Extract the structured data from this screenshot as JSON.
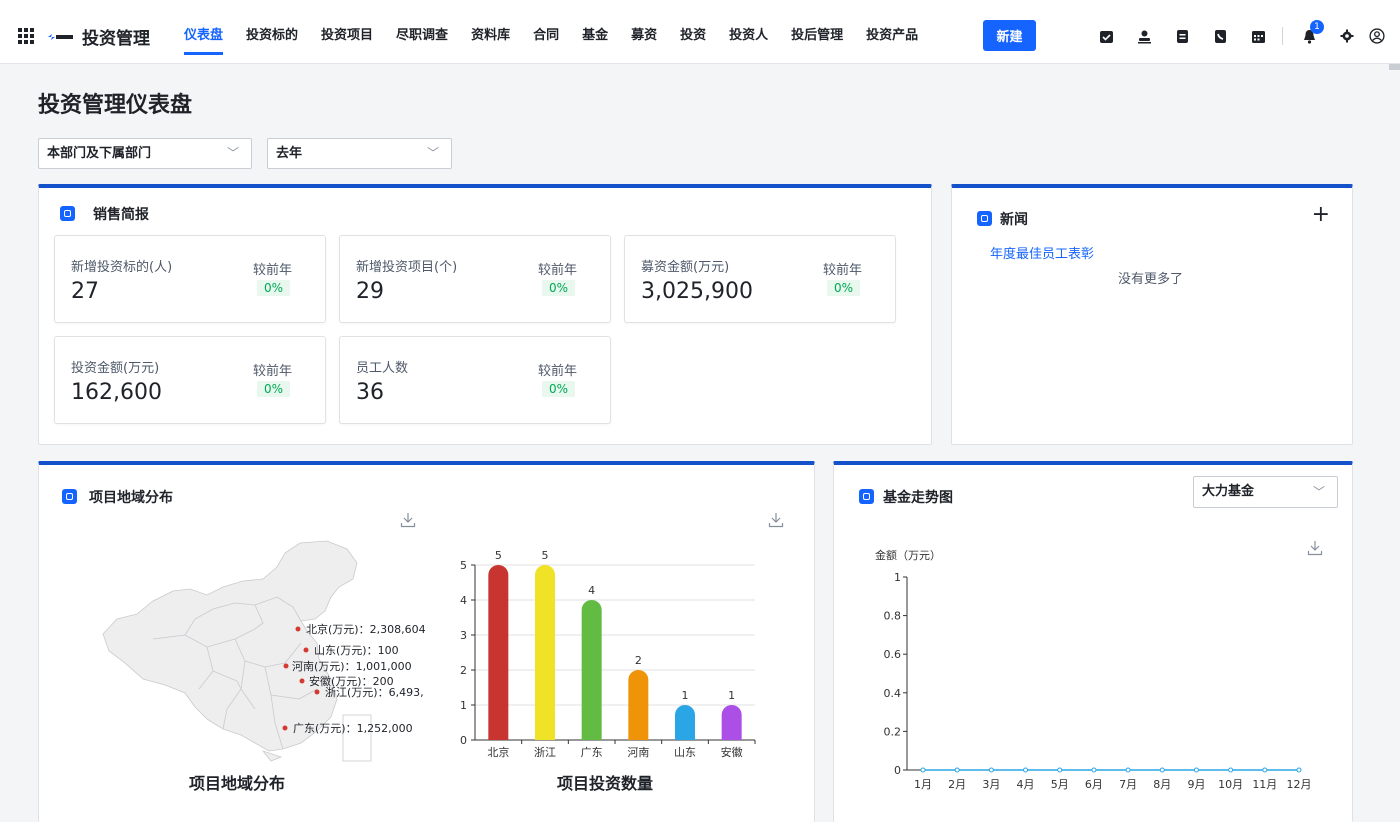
{
  "header": {
    "app_title": "投资管理",
    "nav": [
      "仪表盘",
      "投资标的",
      "投资项目",
      "尽职调查",
      "资料库",
      "合同",
      "基金",
      "募资",
      "投资",
      "投资人",
      "投后管理",
      "投资产品"
    ],
    "new_label": "新建",
    "notification_count": "1",
    "icons": [
      "calendar-check-icon",
      "user-icon",
      "note-icon",
      "contact-book-icon",
      "calendar-icon",
      "bell-icon",
      "settings-icon",
      "profile-icon"
    ]
  },
  "page": {
    "title": "投资管理仪表盘",
    "dept_filter": "本部门及下属部门",
    "period_filter": "去年"
  },
  "sales_brief": {
    "title": "销售简报",
    "compare_label": "较前年",
    "stats": [
      {
        "label": "新增投资标的(人)",
        "value": "27",
        "change": "0%"
      },
      {
        "label": "新增投资项目(个)",
        "value": "29",
        "change": "0%"
      },
      {
        "label": "募资金额(万元)",
        "value": "3,025,900",
        "change": "0%"
      },
      {
        "label": "投资金额(万元)",
        "value": "162,600",
        "change": "0%"
      },
      {
        "label": "员工人数",
        "value": "36",
        "change": "0%"
      }
    ]
  },
  "news": {
    "title": "新闻",
    "add_label": "+",
    "items": [
      "年度最佳员工表彰"
    ],
    "empty_text": "没有更多了"
  },
  "region": {
    "title": "项目地域分布",
    "map_caption": "项目地域分布",
    "bar_caption": "项目投资数量",
    "map_points": [
      {
        "label": "北京(万元)：2,308,604"
      },
      {
        "label": "山东(万元)：100"
      },
      {
        "label": "河南(万元)：1,001,000"
      },
      {
        "label": "安徽(万元)：200"
      },
      {
        "label": "浙江(万元)：6,493,"
      },
      {
        "label": "广东(万元)：1,252,000"
      }
    ]
  },
  "fund": {
    "title": "基金走势图",
    "selected_fund": "大力基金"
  },
  "colors": {
    "accent": "#1664ff",
    "card_border": "#1452cc",
    "positive": "#00a854",
    "map_point": "#d33a31"
  },
  "chart_data": [
    {
      "type": "bar",
      "title": "项目投资数量",
      "categories": [
        "北京",
        "浙江",
        "广东",
        "河南",
        "山东",
        "安徽"
      ],
      "values": [
        5,
        5,
        4,
        2,
        1,
        1
      ],
      "colors": [
        "#c8342f",
        "#f0e227",
        "#62bb43",
        "#ef9408",
        "#2aa5e6",
        "#ab4fe6"
      ],
      "ylim": [
        0,
        5
      ],
      "yticks": [
        0,
        1,
        2,
        3,
        4,
        5
      ],
      "grid": true
    },
    {
      "type": "line",
      "title": "",
      "ylabel": "金额（万元）",
      "categories": [
        "1月",
        "2月",
        "3月",
        "4月",
        "5月",
        "6月",
        "7月",
        "8月",
        "9月",
        "10月",
        "11月",
        "12月"
      ],
      "values": [
        0,
        0,
        0,
        0,
        0,
        0,
        0,
        0,
        0,
        0,
        0,
        0
      ],
      "ylim": [
        0,
        1
      ],
      "yticks": [
        0,
        0.2,
        0.4,
        0.6,
        0.8,
        1
      ],
      "yticklabels": [
        "0",
        "0.2",
        "0.4",
        "0.6",
        "0.8",
        "1"
      ],
      "color": "#2aa5e6"
    }
  ]
}
